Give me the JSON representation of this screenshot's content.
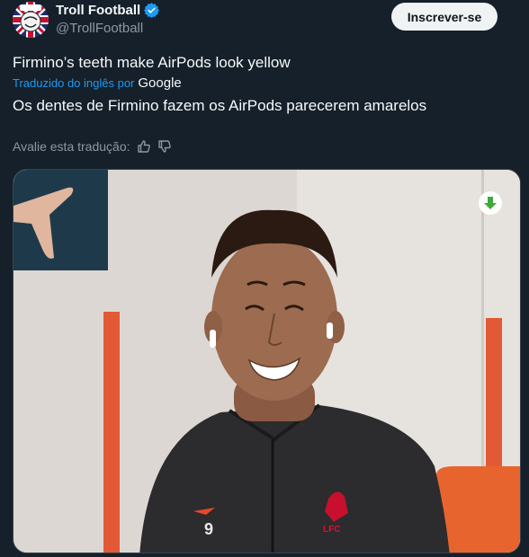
{
  "header": {
    "name": "Troll Football",
    "handle": "@TrollFootball",
    "subscribe_label": "Inscrever-se"
  },
  "tweet": {
    "original_text": "Firmino’s teeth make AirPods look yellow",
    "translated_by": "Traduzido do inglês por",
    "translator": "Google",
    "translated_text": "Os dentes de Firmino fazem os AirPods parecerem amarelos"
  },
  "rate_translation": {
    "label": "Avalie esta tradução:"
  },
  "media": {
    "jersey_number": "9",
    "jersey_badge": "LFC"
  },
  "colors": {
    "background": "#15202b",
    "accent": "#1d9bf0",
    "muted": "#8b98a5",
    "download_green": "#3ea93a"
  },
  "icons": [
    "verified-badge-icon",
    "thumbs-up-icon",
    "thumbs-down-icon",
    "download-icon"
  ]
}
